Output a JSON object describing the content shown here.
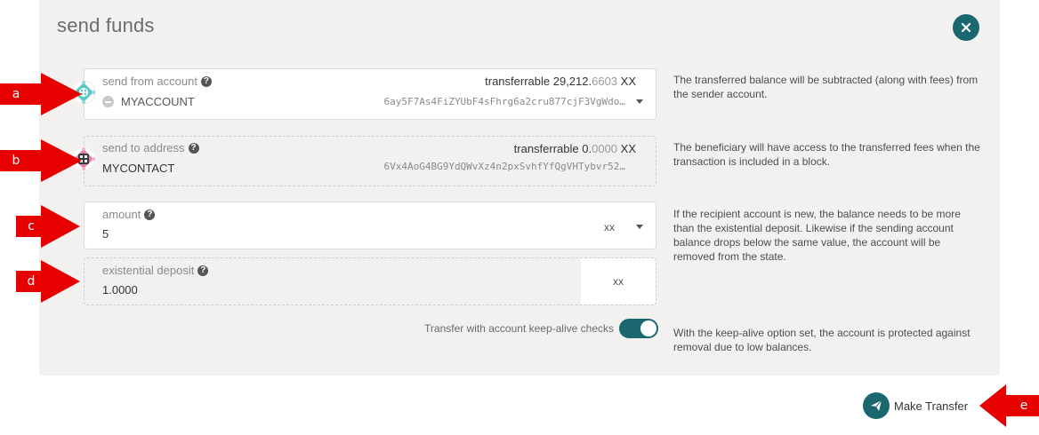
{
  "modal": {
    "title": "send funds",
    "close_icon": "close-icon"
  },
  "from": {
    "label": "send from account",
    "account_name": "MYACCOUNT",
    "address": "6ay5F7As4FiZYUbF4sFhrg6a2cru877cjF3VgWdo…",
    "transferrable_label": "transferrable",
    "transferrable_int": "29,212.",
    "transferrable_dec": "6603",
    "unit": "XX",
    "help": "The transferred balance will be subtracted (along with fees) from the sender account."
  },
  "to": {
    "label": "send to address",
    "account_name": "MYCONTACT",
    "address": "6Vx4AoG4BG9YdQWvXz4n2pxSvhfYfQgVHTybvr52…",
    "transferrable_label": "transferrable",
    "transferrable_int": "0.",
    "transferrable_dec": "0000",
    "unit": "XX",
    "help": "The beneficiary will have access to the transferred fees when the transaction is included in a block."
  },
  "amount": {
    "label": "amount",
    "value": "5",
    "unit": "xx",
    "help": "If the recipient account is new, the balance needs to be more than the existential deposit. Likewise if the sending account balance drops below the same value, the account will be removed from the state."
  },
  "existential": {
    "label": "existential deposit",
    "value": "1.0000",
    "unit": "xx"
  },
  "keepalive": {
    "label": "Transfer with account keep-alive checks",
    "enabled": true,
    "help": "With the keep-alive option set, the account is protected against removal due to low balances."
  },
  "action": {
    "make_transfer": "Make Transfer"
  },
  "annotations": {
    "a": "a",
    "b": "b",
    "c": "c",
    "d": "d",
    "e": "e"
  },
  "colors": {
    "accent": "#1b6770",
    "annotation": "#e60000",
    "modal_bg": "#f2f1f0"
  }
}
